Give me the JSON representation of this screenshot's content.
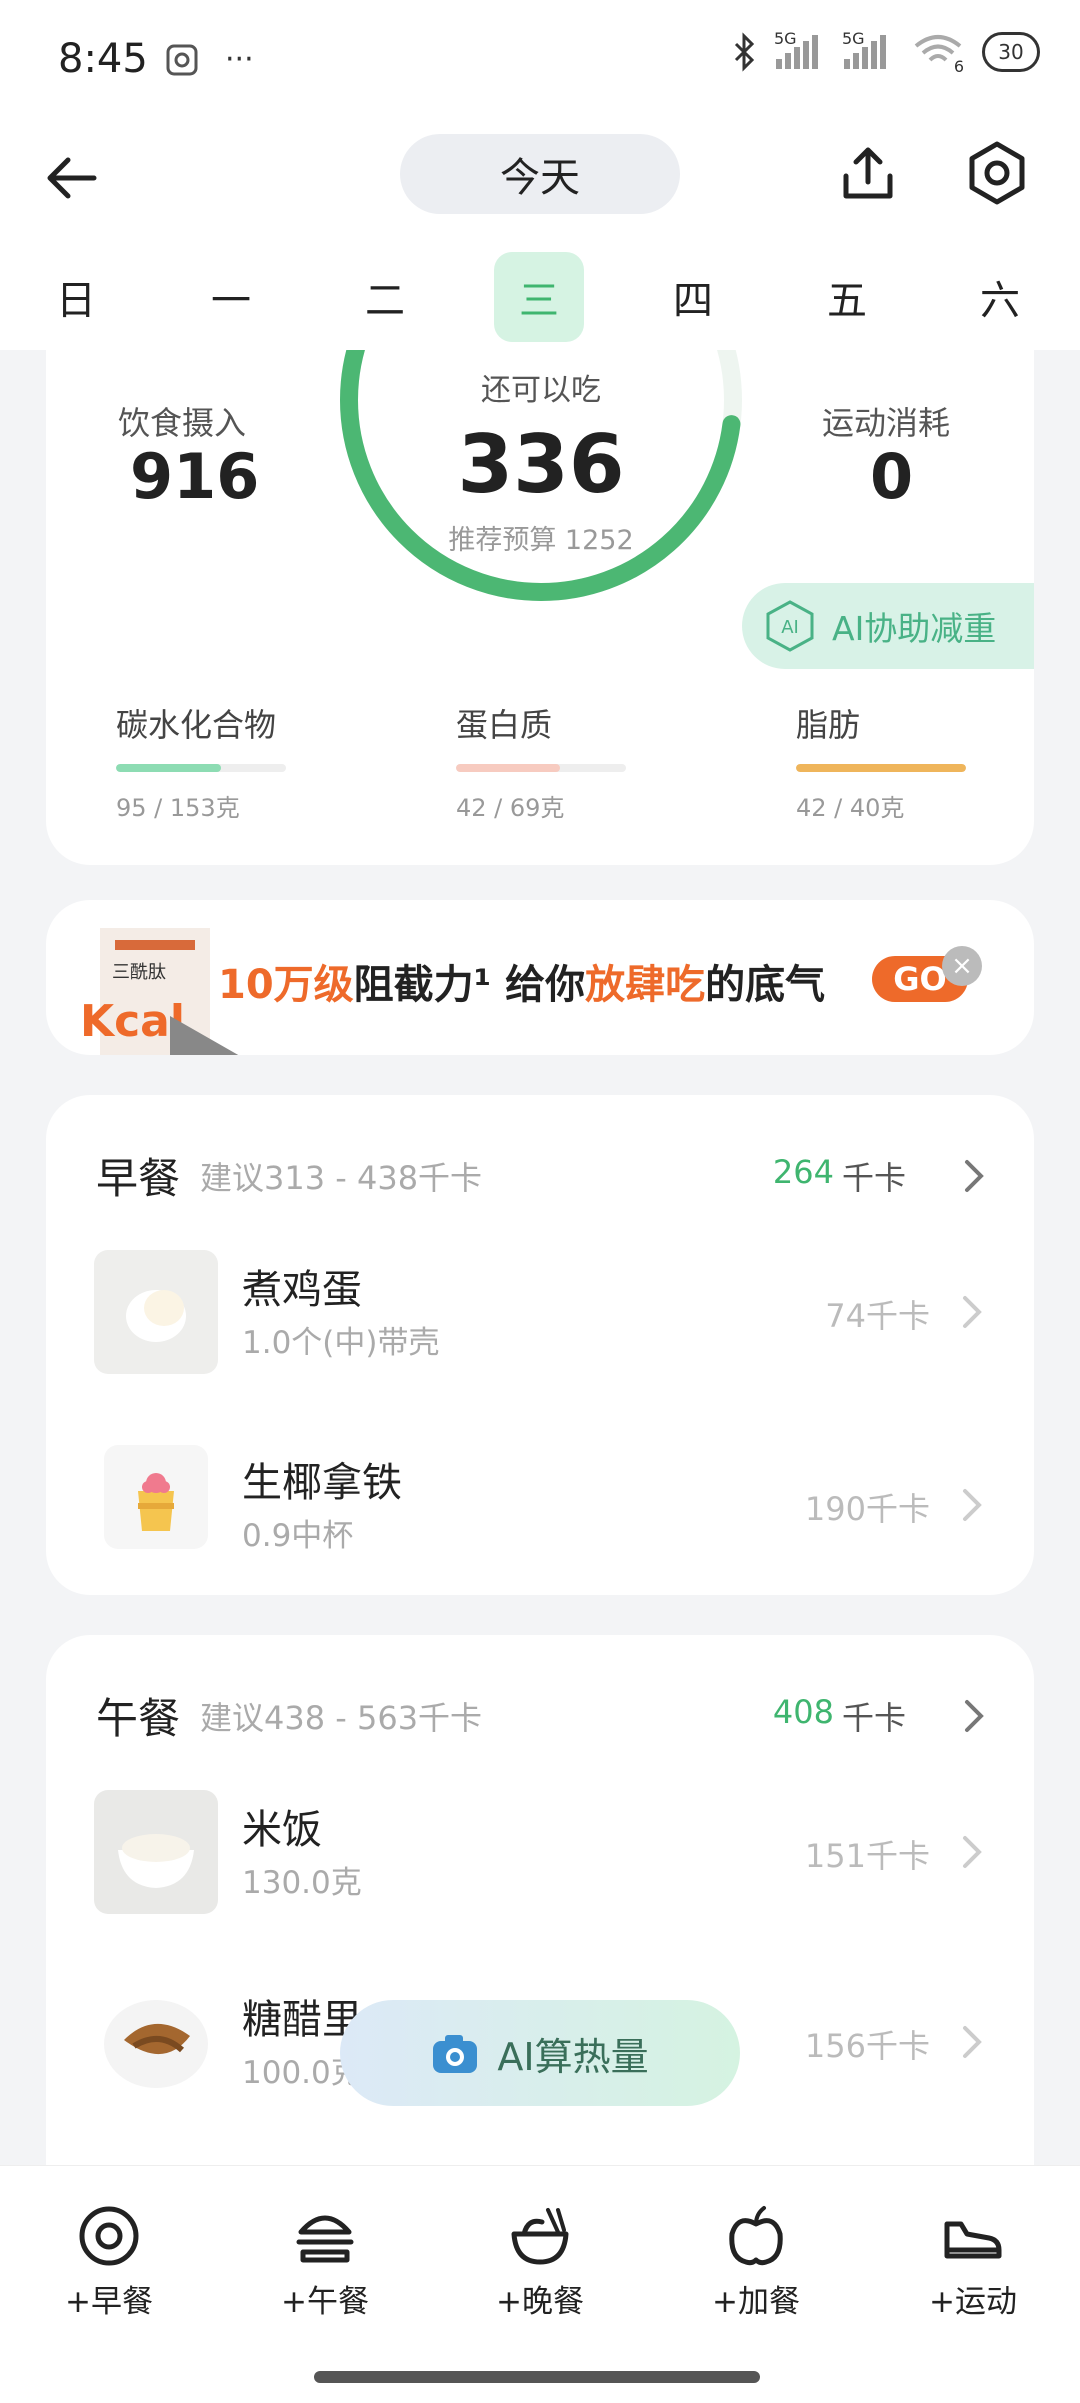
{
  "status": {
    "time": "8:45",
    "more": "···",
    "net1": "5G",
    "net2": "5G",
    "wifi_sub": "6",
    "battery": "30"
  },
  "header": {
    "title": "今天"
  },
  "week": [
    "日",
    "一",
    "二",
    "三",
    "四",
    "五",
    "六"
  ],
  "summary": {
    "intake_label": "饮食摄入",
    "intake_value": "916",
    "remain_label": "还可以吃",
    "remain_value": "336",
    "budget_text": "推荐预算 1252",
    "exercise_label": "运动消耗",
    "exercise_value": "0",
    "ai_button": "AI协助减重",
    "remaining_fraction": 0.27
  },
  "macros": [
    {
      "name": "碳水化合物",
      "value": "95 / 153克",
      "fraction": 0.62,
      "color": "#8ddcb3"
    },
    {
      "name": "蛋白质",
      "value": "42 / 69克",
      "fraction": 0.61,
      "color": "#f7cbc0"
    },
    {
      "name": "脂肪",
      "value": "42 / 40克",
      "fraction": 1.0,
      "color": "#efb55b"
    }
  ],
  "ad": {
    "t1": "10万级",
    "t2": "阻截力",
    "t3": "¹ 给你",
    "t4": "放肆吃",
    "t5": "的底气",
    "go": "GO",
    "close": "×"
  },
  "breakfast": {
    "title": "早餐",
    "suggest": "建议313 - 438千卡",
    "kcal": "264",
    "unit": "千卡",
    "items": [
      {
        "name": "煮鸡蛋",
        "qty": "1.0个(中)带壳",
        "kcal": "74千卡"
      },
      {
        "name": "生椰拿铁",
        "qty": "0.9中杯",
        "kcal": "190千卡"
      }
    ]
  },
  "lunch": {
    "title": "午餐",
    "suggest": "建议438 - 563千卡",
    "kcal": "408",
    "unit": "千卡",
    "items": [
      {
        "name": "米饭",
        "qty": "130.0克",
        "kcal": "151千卡"
      },
      {
        "name": "糖醋里",
        "qty": "100.0克",
        "kcal": "156千卡"
      }
    ]
  },
  "fab": {
    "label": "AI算热量"
  },
  "tabs": [
    "+早餐",
    "+午餐",
    "+晚餐",
    "+加餐",
    "+运动"
  ]
}
